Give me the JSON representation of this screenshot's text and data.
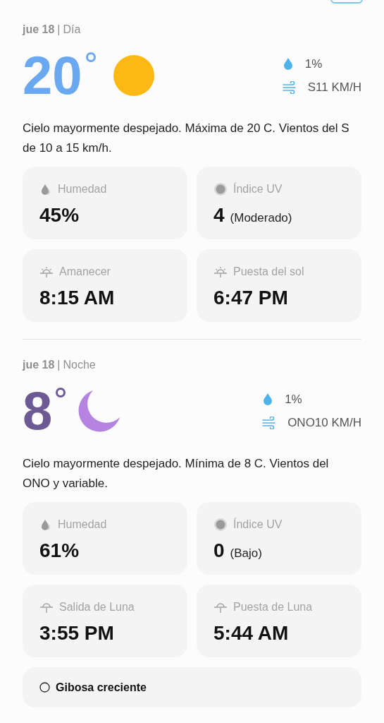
{
  "sections": [
    {
      "kind": "day",
      "date": "jue 18",
      "separator": "|",
      "period": "Día",
      "temperature": "20",
      "precipitation": "1%",
      "wind": "S11 KM/H",
      "description": "Cielo mayormente despejado. Máxima de 20 C. Vientos del S de 10 a 15 km/h.",
      "cards": [
        {
          "kind": "humidity",
          "label": "Humedad",
          "value": "45%"
        },
        {
          "kind": "uv",
          "label": "Índice UV",
          "value": "4",
          "note": "(Moderado)"
        },
        {
          "kind": "sun",
          "label": "Amanecer",
          "value": "8:15 AM"
        },
        {
          "kind": "sun",
          "label": "Puesta del sol",
          "value": "6:47 PM"
        }
      ]
    },
    {
      "kind": "night",
      "date": "jue 18",
      "separator": "|",
      "period": "Noche",
      "temperature": "8",
      "precipitation": "1%",
      "wind": "ONO10 KM/H",
      "description": "Cielo mayormente despejado. Mínima de 8 C. Vientos del ONO y variable.",
      "cards": [
        {
          "kind": "humidity",
          "label": "Humedad",
          "value": "61%"
        },
        {
          "kind": "uv",
          "label": "Índice UV",
          "value": "0",
          "note": "(Bajo)"
        },
        {
          "kind": "moon",
          "label": "Salida de Luna",
          "value": "3:55 PM"
        },
        {
          "kind": "moon",
          "label": "Puesta de Luna",
          "value": "5:44 AM"
        }
      ],
      "moon_phase": "Gibosa creciente"
    }
  ]
}
